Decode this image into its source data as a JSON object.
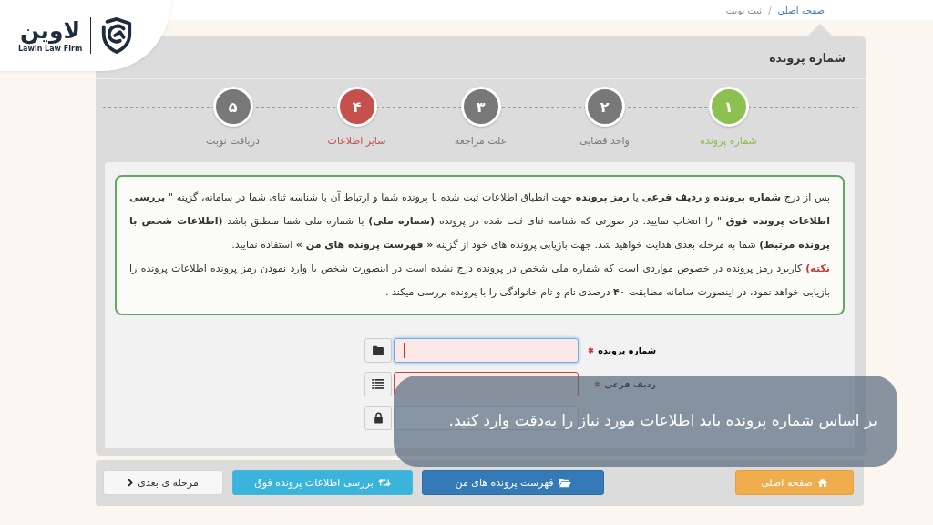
{
  "logo": {
    "name": "لاوین",
    "subtitle": "Lawin Law Firm"
  },
  "breadcrumb": {
    "items": [
      {
        "label": "صفحه اصلی",
        "kind": "link"
      },
      {
        "label": "ثبت نوبت",
        "kind": "current"
      }
    ],
    "separator": "/"
  },
  "panel": {
    "title": "شماره پرونده"
  },
  "steps": [
    {
      "number": "۱",
      "label": "شماره پرونده",
      "selected": true,
      "error": false
    },
    {
      "number": "۲",
      "label": "واحد قضایی",
      "selected": false,
      "error": false
    },
    {
      "number": "۳",
      "label": "علت مراجعه",
      "selected": false,
      "error": false
    },
    {
      "number": "۴",
      "label": "سایر اطلاعات",
      "selected": false,
      "error": true
    },
    {
      "number": "۵",
      "label": "دریافت نوبت",
      "selected": false,
      "error": false
    }
  ],
  "note": {
    "paragraphs": [
      {
        "text": "پس از درج **شماره پرونده** و **ردیف فرعی** یا **رمز پرونده** جهت انطباق اطلاعات ثبت شده با پرونده شما و ارتباط آن با شناسه ثنای شما در سامانه، گزینه \" **بررسی اطلاعات پرونده فوق** \" را انتخاب نمایید. در صورتی که شناسه ثنای ثبت شده در پرونده **(شماره ملی)** با شماره ملی شما منطبق باشد **(اطلاعات شخص با پرونده مرتبط)** شما به مرحله بعدی هدایت خواهید شد. جهت بازیابی پرونده های خود از گزینه **« فهرست پرونده های من »** استفاده نمایید."
      },
      {
        "label": "نکته)",
        "text": "کاربرد رمز پرونده در خصوص مواردی است که شماره ملی شخص در پرونده درج نشده است در اینصورت شخص با وارد نمودن رمز پرونده اطلاعات پرونده را بازیابی خواهد نمود، در اینصورت سامانه مطابقت **۴۰** درصدی نام و نام خانوادگی را با پرونده بررسی میکند ."
      }
    ]
  },
  "form": {
    "fields": [
      {
        "label": "شماره پرونده",
        "required": true,
        "invalid": true,
        "focused": true
      },
      {
        "label": "ردیف فرعی",
        "required": true,
        "invalid": true,
        "focused": false
      },
      {
        "required": false,
        "invalid": false,
        "focused": false
      }
    ]
  },
  "actions": [
    {
      "label": "صفحه اصلی",
      "kind": "warning"
    },
    {
      "label": "فهرست پرونده های من",
      "kind": "primary"
    },
    {
      "label": "بررسی اطلاعات پرونده فوق",
      "kind": "info"
    },
    {
      "label": "مرحله ی بعدی",
      "kind": "default"
    }
  ],
  "caption": {
    "text": "بر اساس شماره پرونده باید اطلاعات مورد نیاز را به‌دقت وارد کنید."
  }
}
